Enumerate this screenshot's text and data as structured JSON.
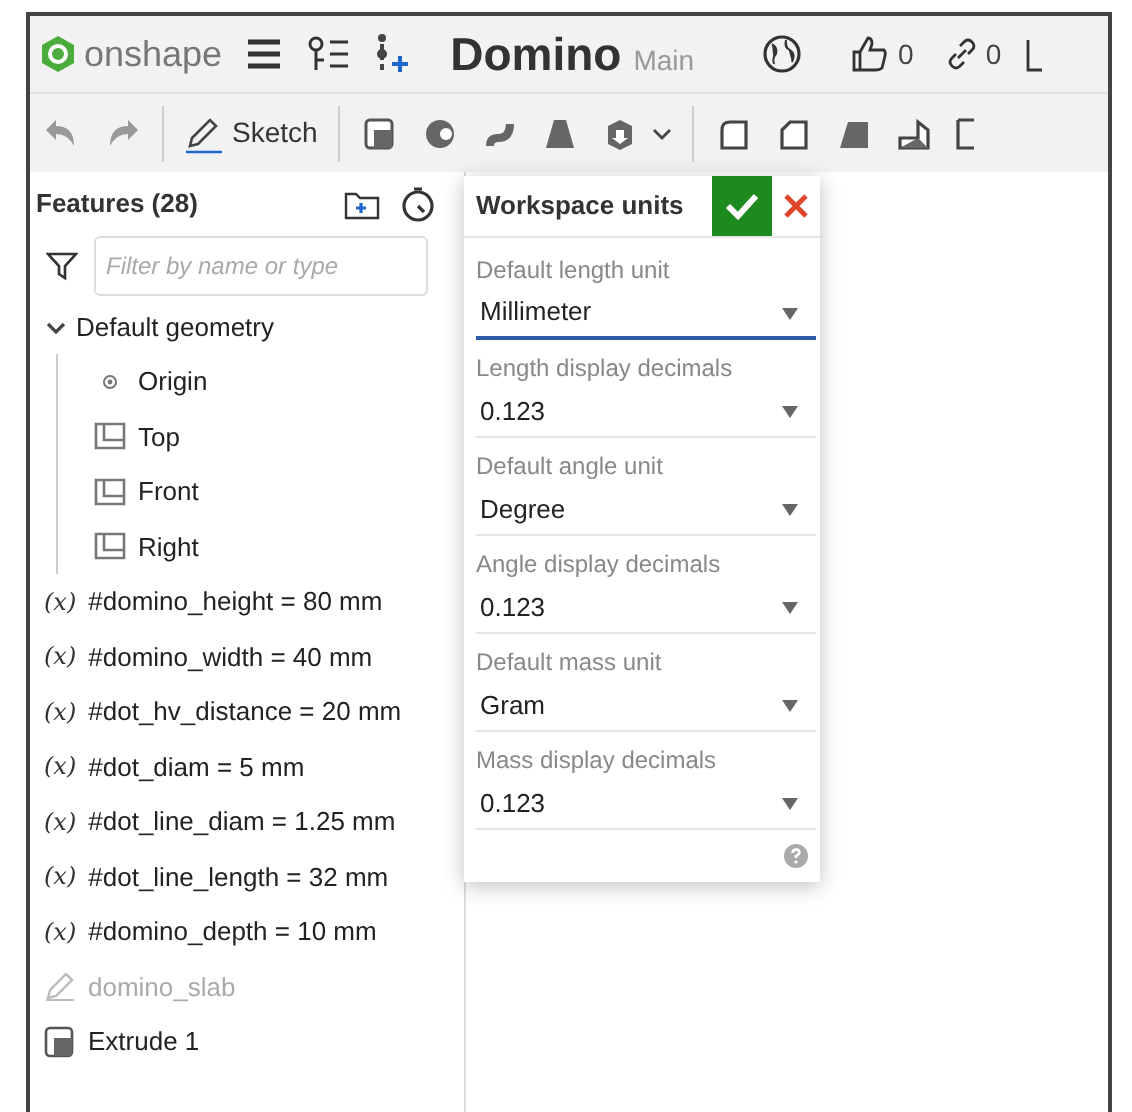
{
  "app": {
    "brand": "onshape",
    "title": "Domino",
    "branch": "Main",
    "likes": "0",
    "links": "0"
  },
  "toolbar": {
    "sketch_label": "Sketch"
  },
  "features": {
    "title": "Features (28)",
    "filter_placeholder": "Filter by name or type",
    "items": [
      {
        "kind": "group",
        "label": "Default geometry",
        "expanded": true,
        "children": [
          {
            "kind": "origin",
            "label": "Origin"
          },
          {
            "kind": "plane",
            "label": "Top"
          },
          {
            "kind": "plane",
            "label": "Front"
          },
          {
            "kind": "plane",
            "label": "Right"
          }
        ]
      },
      {
        "kind": "variable",
        "icon": "(x)",
        "label": "#domino_height = 80 mm"
      },
      {
        "kind": "variable",
        "icon": "(x)",
        "label": "#domino_width = 40 mm"
      },
      {
        "kind": "variable",
        "icon": "(x)",
        "label": "#dot_hv_distance = 20 mm"
      },
      {
        "kind": "variable",
        "icon": "(x)",
        "label": "#dot_diam = 5 mm"
      },
      {
        "kind": "variable",
        "icon": "(x)",
        "label": "#dot_line_diam = 1.25 mm"
      },
      {
        "kind": "variable",
        "icon": "(x)",
        "label": "#dot_line_length = 32 mm"
      },
      {
        "kind": "variable",
        "icon": "(x)",
        "label": "#domino_depth = 10 mm"
      },
      {
        "kind": "sketch",
        "label": "domino_slab",
        "disabled": true
      },
      {
        "kind": "extrude",
        "label": "Extrude 1"
      }
    ]
  },
  "dialog": {
    "title": "Workspace units",
    "fields": [
      {
        "label": "Default length unit",
        "value": "Millimeter",
        "focused": true
      },
      {
        "label": "Length display decimals",
        "value": "0.123",
        "focused": false
      },
      {
        "label": "Default angle unit",
        "value": "Degree",
        "focused": false
      },
      {
        "label": "Angle display decimals",
        "value": "0.123",
        "focused": false
      },
      {
        "label": "Default mass unit",
        "value": "Gram",
        "focused": false
      },
      {
        "label": "Mass display decimals",
        "value": "0.123",
        "focused": false
      }
    ]
  }
}
